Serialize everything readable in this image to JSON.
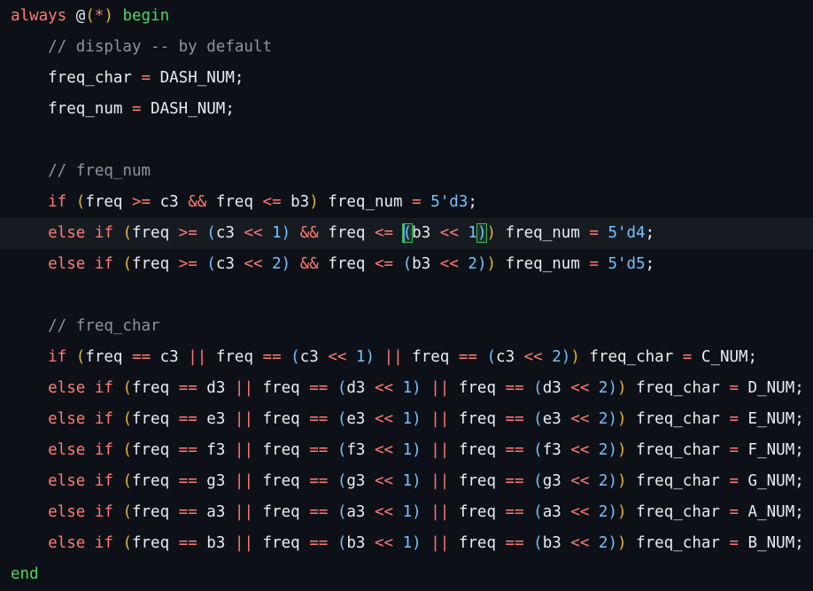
{
  "editor": {
    "language": "verilog",
    "colors": {
      "background": "#0d1117",
      "current_line": "#161b22",
      "keyword": "#ff7b72",
      "comment": "#8b949e",
      "number": "#79c0ff",
      "identifier": "#e6edf3",
      "paren_outer": "#e3b341",
      "paren_inner": "#79c0ff",
      "begin_end": "#56d364"
    },
    "current_line_index": 7,
    "lines": [
      [
        {
          "t": "kw",
          "v": "always "
        },
        {
          "t": "punct",
          "v": "@"
        },
        {
          "t": "paren",
          "v": "("
        },
        {
          "t": "op",
          "v": "*"
        },
        {
          "t": "paren",
          "v": ")"
        },
        {
          "t": "green",
          "v": " begin"
        }
      ],
      [
        {
          "t": "comment",
          "v": "    // display -- by default"
        }
      ],
      [
        {
          "t": "ident",
          "v": "    freq_char "
        },
        {
          "t": "op",
          "v": "="
        },
        {
          "t": "ident",
          "v": " DASH_NUM;"
        }
      ],
      [
        {
          "t": "ident",
          "v": "    freq_num "
        },
        {
          "t": "op",
          "v": "="
        },
        {
          "t": "ident",
          "v": " DASH_NUM;"
        }
      ],
      [],
      [
        {
          "t": "comment",
          "v": "    // freq_num"
        }
      ],
      [
        {
          "t": "kw",
          "v": "    if "
        },
        {
          "t": "paren",
          "v": "("
        },
        {
          "t": "ident",
          "v": "freq "
        },
        {
          "t": "op",
          "v": ">="
        },
        {
          "t": "ident",
          "v": " c3 "
        },
        {
          "t": "op",
          "v": "&&"
        },
        {
          "t": "ident",
          "v": " freq "
        },
        {
          "t": "op",
          "v": "<="
        },
        {
          "t": "ident",
          "v": " b3"
        },
        {
          "t": "paren",
          "v": ")"
        },
        {
          "t": "ident",
          "v": " freq_num "
        },
        {
          "t": "op",
          "v": "="
        },
        {
          "t": "num",
          "v": " 5'd3"
        },
        {
          "t": "ident",
          "v": ";"
        }
      ],
      [
        {
          "t": "kw",
          "v": "    else if "
        },
        {
          "t": "paren",
          "v": "("
        },
        {
          "t": "ident",
          "v": "freq "
        },
        {
          "t": "op",
          "v": ">="
        },
        {
          "t": "ident",
          "v": " "
        },
        {
          "t": "paren2",
          "v": "("
        },
        {
          "t": "ident",
          "v": "c3 "
        },
        {
          "t": "op",
          "v": "<<"
        },
        {
          "t": "num",
          "v": " 1"
        },
        {
          "t": "paren2",
          "v": ")"
        },
        {
          "t": "ident",
          "v": " "
        },
        {
          "t": "op",
          "v": "&&"
        },
        {
          "t": "ident",
          "v": " freq "
        },
        {
          "t": "op",
          "v": "<="
        },
        {
          "t": "ident",
          "v": " "
        },
        {
          "t": "cursor",
          "v": ""
        },
        {
          "t": "match",
          "v": "("
        },
        {
          "t": "ident",
          "v": "b3 "
        },
        {
          "t": "op",
          "v": "<<"
        },
        {
          "t": "num",
          "v": " 1"
        },
        {
          "t": "match",
          "v": ")"
        },
        {
          "t": "paren",
          "v": ")"
        },
        {
          "t": "ident",
          "v": " freq_num "
        },
        {
          "t": "op",
          "v": "="
        },
        {
          "t": "num",
          "v": " 5'd4"
        },
        {
          "t": "ident",
          "v": ";"
        }
      ],
      [
        {
          "t": "kw",
          "v": "    else if "
        },
        {
          "t": "paren",
          "v": "("
        },
        {
          "t": "ident",
          "v": "freq "
        },
        {
          "t": "op",
          "v": ">="
        },
        {
          "t": "ident",
          "v": " "
        },
        {
          "t": "paren2",
          "v": "("
        },
        {
          "t": "ident",
          "v": "c3 "
        },
        {
          "t": "op",
          "v": "<<"
        },
        {
          "t": "num",
          "v": " 2"
        },
        {
          "t": "paren2",
          "v": ")"
        },
        {
          "t": "ident",
          "v": " "
        },
        {
          "t": "op",
          "v": "&&"
        },
        {
          "t": "ident",
          "v": " freq "
        },
        {
          "t": "op",
          "v": "<="
        },
        {
          "t": "ident",
          "v": " "
        },
        {
          "t": "paren2",
          "v": "("
        },
        {
          "t": "ident",
          "v": "b3 "
        },
        {
          "t": "op",
          "v": "<<"
        },
        {
          "t": "num",
          "v": " 2"
        },
        {
          "t": "paren2",
          "v": ")"
        },
        {
          "t": "paren",
          "v": ")"
        },
        {
          "t": "ident",
          "v": " freq_num "
        },
        {
          "t": "op",
          "v": "="
        },
        {
          "t": "num",
          "v": " 5'd5"
        },
        {
          "t": "ident",
          "v": ";"
        }
      ],
      [],
      [
        {
          "t": "comment",
          "v": "    // freq_char"
        }
      ],
      [
        {
          "t": "kw",
          "v": "    if "
        },
        {
          "t": "paren",
          "v": "("
        },
        {
          "t": "ident",
          "v": "freq "
        },
        {
          "t": "op",
          "v": "=="
        },
        {
          "t": "ident",
          "v": " c3 "
        },
        {
          "t": "op",
          "v": "||"
        },
        {
          "t": "ident",
          "v": " freq "
        },
        {
          "t": "op",
          "v": "=="
        },
        {
          "t": "ident",
          "v": " "
        },
        {
          "t": "paren2",
          "v": "("
        },
        {
          "t": "ident",
          "v": "c3 "
        },
        {
          "t": "op",
          "v": "<<"
        },
        {
          "t": "num",
          "v": " 1"
        },
        {
          "t": "paren2",
          "v": ")"
        },
        {
          "t": "ident",
          "v": " "
        },
        {
          "t": "op",
          "v": "||"
        },
        {
          "t": "ident",
          "v": " freq "
        },
        {
          "t": "op",
          "v": "=="
        },
        {
          "t": "ident",
          "v": " "
        },
        {
          "t": "paren2",
          "v": "("
        },
        {
          "t": "ident",
          "v": "c3 "
        },
        {
          "t": "op",
          "v": "<<"
        },
        {
          "t": "num",
          "v": " 2"
        },
        {
          "t": "paren2",
          "v": ")"
        },
        {
          "t": "paren",
          "v": ")"
        },
        {
          "t": "ident",
          "v": " freq_char "
        },
        {
          "t": "op",
          "v": "="
        },
        {
          "t": "ident",
          "v": " C_NUM;"
        }
      ],
      [
        {
          "t": "kw",
          "v": "    else if "
        },
        {
          "t": "paren",
          "v": "("
        },
        {
          "t": "ident",
          "v": "freq "
        },
        {
          "t": "op",
          "v": "=="
        },
        {
          "t": "ident",
          "v": " d3 "
        },
        {
          "t": "op",
          "v": "||"
        },
        {
          "t": "ident",
          "v": " freq "
        },
        {
          "t": "op",
          "v": "=="
        },
        {
          "t": "ident",
          "v": " "
        },
        {
          "t": "paren2",
          "v": "("
        },
        {
          "t": "ident",
          "v": "d3 "
        },
        {
          "t": "op",
          "v": "<<"
        },
        {
          "t": "num",
          "v": " 1"
        },
        {
          "t": "paren2",
          "v": ")"
        },
        {
          "t": "ident",
          "v": " "
        },
        {
          "t": "op",
          "v": "||"
        },
        {
          "t": "ident",
          "v": " freq "
        },
        {
          "t": "op",
          "v": "=="
        },
        {
          "t": "ident",
          "v": " "
        },
        {
          "t": "paren2",
          "v": "("
        },
        {
          "t": "ident",
          "v": "d3 "
        },
        {
          "t": "op",
          "v": "<<"
        },
        {
          "t": "num",
          "v": " 2"
        },
        {
          "t": "paren2",
          "v": ")"
        },
        {
          "t": "paren",
          "v": ")"
        },
        {
          "t": "ident",
          "v": " freq_char "
        },
        {
          "t": "op",
          "v": "="
        },
        {
          "t": "ident",
          "v": " D_NUM;"
        }
      ],
      [
        {
          "t": "kw",
          "v": "    else if "
        },
        {
          "t": "paren",
          "v": "("
        },
        {
          "t": "ident",
          "v": "freq "
        },
        {
          "t": "op",
          "v": "=="
        },
        {
          "t": "ident",
          "v": " e3 "
        },
        {
          "t": "op",
          "v": "||"
        },
        {
          "t": "ident",
          "v": " freq "
        },
        {
          "t": "op",
          "v": "=="
        },
        {
          "t": "ident",
          "v": " "
        },
        {
          "t": "paren2",
          "v": "("
        },
        {
          "t": "ident",
          "v": "e3 "
        },
        {
          "t": "op",
          "v": "<<"
        },
        {
          "t": "num",
          "v": " 1"
        },
        {
          "t": "paren2",
          "v": ")"
        },
        {
          "t": "ident",
          "v": " "
        },
        {
          "t": "op",
          "v": "||"
        },
        {
          "t": "ident",
          "v": " freq "
        },
        {
          "t": "op",
          "v": "=="
        },
        {
          "t": "ident",
          "v": " "
        },
        {
          "t": "paren2",
          "v": "("
        },
        {
          "t": "ident",
          "v": "e3 "
        },
        {
          "t": "op",
          "v": "<<"
        },
        {
          "t": "num",
          "v": " 2"
        },
        {
          "t": "paren2",
          "v": ")"
        },
        {
          "t": "paren",
          "v": ")"
        },
        {
          "t": "ident",
          "v": " freq_char "
        },
        {
          "t": "op",
          "v": "="
        },
        {
          "t": "ident",
          "v": " E_NUM;"
        }
      ],
      [
        {
          "t": "kw",
          "v": "    else if "
        },
        {
          "t": "paren",
          "v": "("
        },
        {
          "t": "ident",
          "v": "freq "
        },
        {
          "t": "op",
          "v": "=="
        },
        {
          "t": "ident",
          "v": " f3 "
        },
        {
          "t": "op",
          "v": "||"
        },
        {
          "t": "ident",
          "v": " freq "
        },
        {
          "t": "op",
          "v": "=="
        },
        {
          "t": "ident",
          "v": " "
        },
        {
          "t": "paren2",
          "v": "("
        },
        {
          "t": "ident",
          "v": "f3 "
        },
        {
          "t": "op",
          "v": "<<"
        },
        {
          "t": "num",
          "v": " 1"
        },
        {
          "t": "paren2",
          "v": ")"
        },
        {
          "t": "ident",
          "v": " "
        },
        {
          "t": "op",
          "v": "||"
        },
        {
          "t": "ident",
          "v": " freq "
        },
        {
          "t": "op",
          "v": "=="
        },
        {
          "t": "ident",
          "v": " "
        },
        {
          "t": "paren2",
          "v": "("
        },
        {
          "t": "ident",
          "v": "f3 "
        },
        {
          "t": "op",
          "v": "<<"
        },
        {
          "t": "num",
          "v": " 2"
        },
        {
          "t": "paren2",
          "v": ")"
        },
        {
          "t": "paren",
          "v": ")"
        },
        {
          "t": "ident",
          "v": " freq_char "
        },
        {
          "t": "op",
          "v": "="
        },
        {
          "t": "ident",
          "v": " F_NUM;"
        }
      ],
      [
        {
          "t": "kw",
          "v": "    else if "
        },
        {
          "t": "paren",
          "v": "("
        },
        {
          "t": "ident",
          "v": "freq "
        },
        {
          "t": "op",
          "v": "=="
        },
        {
          "t": "ident",
          "v": " g3 "
        },
        {
          "t": "op",
          "v": "||"
        },
        {
          "t": "ident",
          "v": " freq "
        },
        {
          "t": "op",
          "v": "=="
        },
        {
          "t": "ident",
          "v": " "
        },
        {
          "t": "paren2",
          "v": "("
        },
        {
          "t": "ident",
          "v": "g3 "
        },
        {
          "t": "op",
          "v": "<<"
        },
        {
          "t": "num",
          "v": " 1"
        },
        {
          "t": "paren2",
          "v": ")"
        },
        {
          "t": "ident",
          "v": " "
        },
        {
          "t": "op",
          "v": "||"
        },
        {
          "t": "ident",
          "v": " freq "
        },
        {
          "t": "op",
          "v": "=="
        },
        {
          "t": "ident",
          "v": " "
        },
        {
          "t": "paren2",
          "v": "("
        },
        {
          "t": "ident",
          "v": "g3 "
        },
        {
          "t": "op",
          "v": "<<"
        },
        {
          "t": "num",
          "v": " 2"
        },
        {
          "t": "paren2",
          "v": ")"
        },
        {
          "t": "paren",
          "v": ")"
        },
        {
          "t": "ident",
          "v": " freq_char "
        },
        {
          "t": "op",
          "v": "="
        },
        {
          "t": "ident",
          "v": " G_NUM;"
        }
      ],
      [
        {
          "t": "kw",
          "v": "    else if "
        },
        {
          "t": "paren",
          "v": "("
        },
        {
          "t": "ident",
          "v": "freq "
        },
        {
          "t": "op",
          "v": "=="
        },
        {
          "t": "ident",
          "v": " a3 "
        },
        {
          "t": "op",
          "v": "||"
        },
        {
          "t": "ident",
          "v": " freq "
        },
        {
          "t": "op",
          "v": "=="
        },
        {
          "t": "ident",
          "v": " "
        },
        {
          "t": "paren2",
          "v": "("
        },
        {
          "t": "ident",
          "v": "a3 "
        },
        {
          "t": "op",
          "v": "<<"
        },
        {
          "t": "num",
          "v": " 1"
        },
        {
          "t": "paren2",
          "v": ")"
        },
        {
          "t": "ident",
          "v": " "
        },
        {
          "t": "op",
          "v": "||"
        },
        {
          "t": "ident",
          "v": " freq "
        },
        {
          "t": "op",
          "v": "=="
        },
        {
          "t": "ident",
          "v": " "
        },
        {
          "t": "paren2",
          "v": "("
        },
        {
          "t": "ident",
          "v": "a3 "
        },
        {
          "t": "op",
          "v": "<<"
        },
        {
          "t": "num",
          "v": " 2"
        },
        {
          "t": "paren2",
          "v": ")"
        },
        {
          "t": "paren",
          "v": ")"
        },
        {
          "t": "ident",
          "v": " freq_char "
        },
        {
          "t": "op",
          "v": "="
        },
        {
          "t": "ident",
          "v": " A_NUM;"
        }
      ],
      [
        {
          "t": "kw",
          "v": "    else if "
        },
        {
          "t": "paren",
          "v": "("
        },
        {
          "t": "ident",
          "v": "freq "
        },
        {
          "t": "op",
          "v": "=="
        },
        {
          "t": "ident",
          "v": " b3 "
        },
        {
          "t": "op",
          "v": "||"
        },
        {
          "t": "ident",
          "v": " freq "
        },
        {
          "t": "op",
          "v": "=="
        },
        {
          "t": "ident",
          "v": " "
        },
        {
          "t": "paren2",
          "v": "("
        },
        {
          "t": "ident",
          "v": "b3 "
        },
        {
          "t": "op",
          "v": "<<"
        },
        {
          "t": "num",
          "v": " 1"
        },
        {
          "t": "paren2",
          "v": ")"
        },
        {
          "t": "ident",
          "v": " "
        },
        {
          "t": "op",
          "v": "||"
        },
        {
          "t": "ident",
          "v": " freq "
        },
        {
          "t": "op",
          "v": "=="
        },
        {
          "t": "ident",
          "v": " "
        },
        {
          "t": "paren2",
          "v": "("
        },
        {
          "t": "ident",
          "v": "b3 "
        },
        {
          "t": "op",
          "v": "<<"
        },
        {
          "t": "num",
          "v": " 2"
        },
        {
          "t": "paren2",
          "v": ")"
        },
        {
          "t": "paren",
          "v": ")"
        },
        {
          "t": "ident",
          "v": " freq_char "
        },
        {
          "t": "op",
          "v": "="
        },
        {
          "t": "ident",
          "v": " B_NUM;"
        }
      ],
      [
        {
          "t": "green",
          "v": "end"
        }
      ]
    ]
  }
}
